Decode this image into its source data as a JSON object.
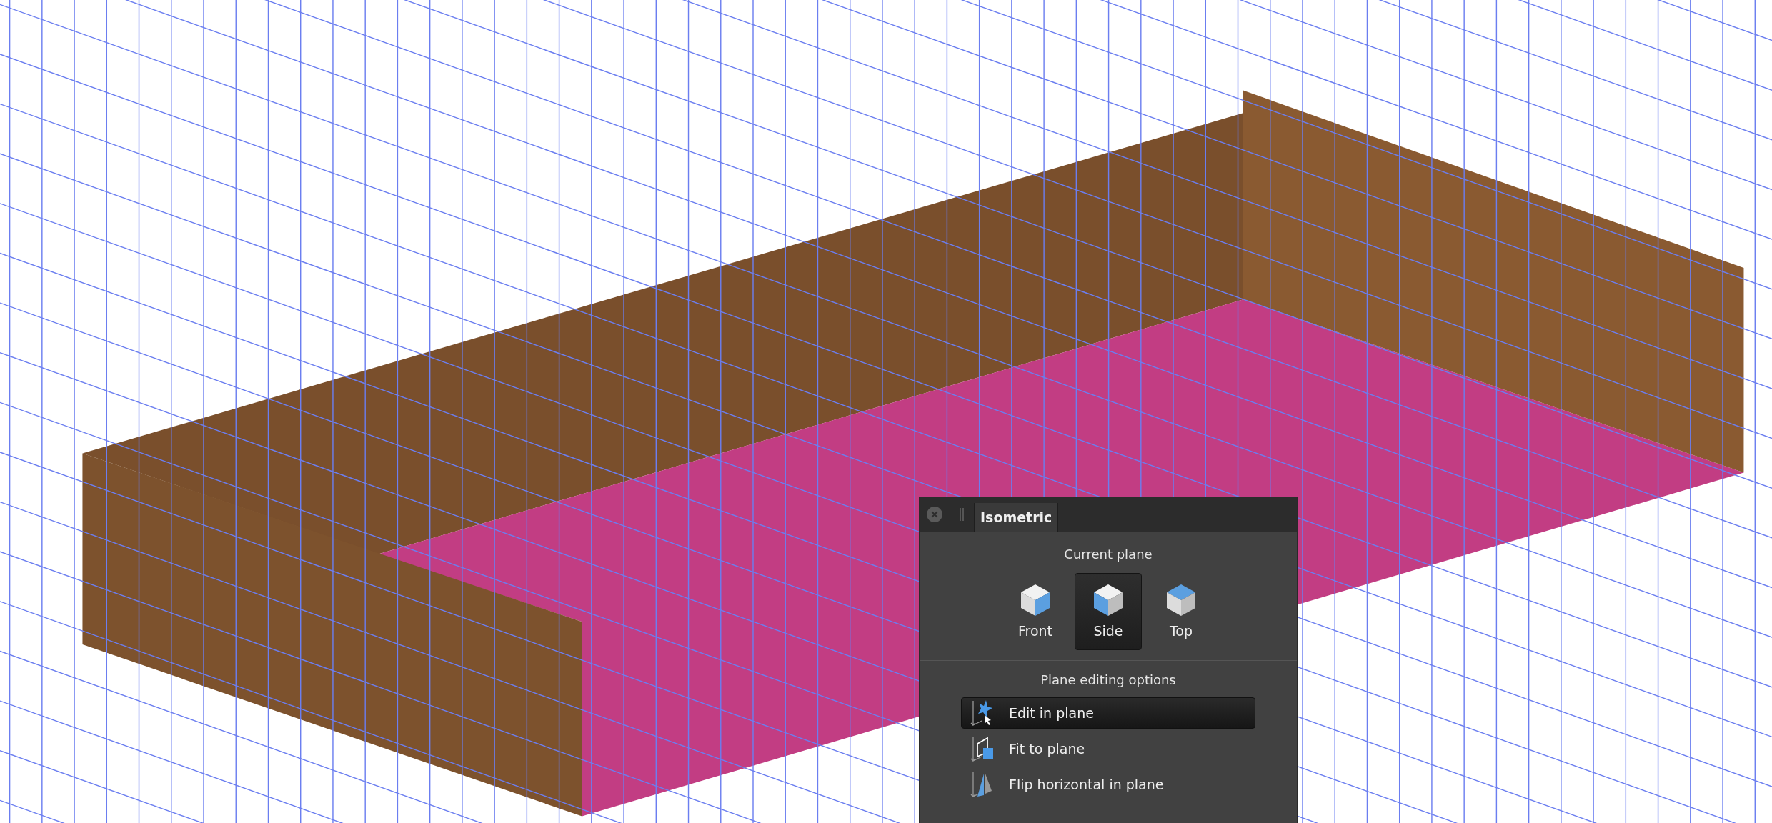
{
  "panel": {
    "title": "Isometric",
    "current_plane": {
      "heading": "Current plane",
      "planes": [
        {
          "label": "Front",
          "kind": "front",
          "selected": false
        },
        {
          "label": "Side",
          "kind": "side",
          "selected": true
        },
        {
          "label": "Top",
          "kind": "top",
          "selected": false
        }
      ]
    },
    "options": {
      "heading": "Plane editing options",
      "items": [
        {
          "label": "Edit in plane",
          "kind": "edit",
          "selected": true
        },
        {
          "label": "Fit to plane",
          "kind": "fit",
          "selected": false
        },
        {
          "label": "Flip horizontal in plane",
          "kind": "flip",
          "selected": false
        }
      ]
    }
  }
}
